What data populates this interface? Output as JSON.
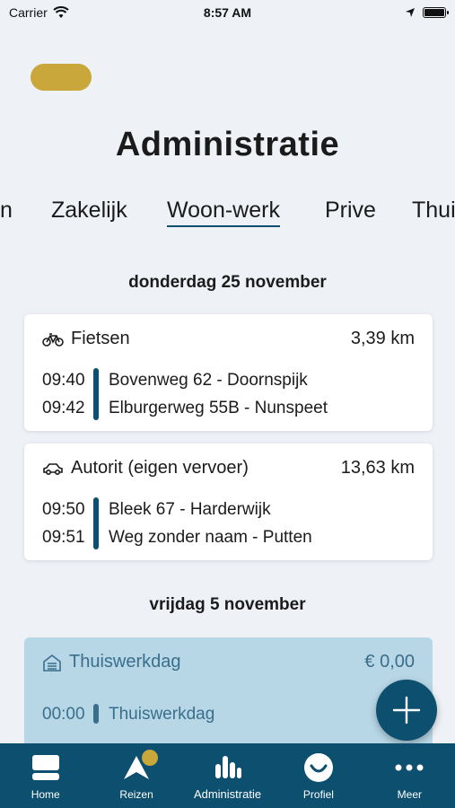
{
  "status_bar": {
    "carrier": "Carrier",
    "time": "8:57 AM"
  },
  "page": {
    "title": "Administratie"
  },
  "tabs": [
    {
      "label": "n",
      "active": false
    },
    {
      "label": "Zakelijk",
      "active": false
    },
    {
      "label": "Woon-werk",
      "active": true
    },
    {
      "label": "Prive",
      "active": false
    },
    {
      "label": "Thui",
      "active": false
    }
  ],
  "sections": [
    {
      "date": "donderdag 25 november",
      "trips": [
        {
          "mode_icon": "bicycle-icon",
          "mode": "Fietsen",
          "distance": "3,39 km",
          "from_time": "09:40",
          "from_addr": "Bovenweg 62 - Doornspijk",
          "to_time": "09:42",
          "to_addr": "Elburgerweg 55B - Nunspeet"
        },
        {
          "mode_icon": "car-icon",
          "mode": "Autorit (eigen vervoer)",
          "distance": "13,63 km",
          "from_time": "09:50",
          "from_addr": "Bleek 67 - Harderwijk",
          "to_time": "09:51",
          "to_addr": "Weg zonder naam - Putten"
        }
      ]
    },
    {
      "date": "vrijdag 5 november",
      "home_day": {
        "icon": "house-icon",
        "label": "Thuiswerkdag",
        "amount": "€ 0,00",
        "time": "00:00",
        "desc": "Thuiswerkdag"
      }
    }
  ],
  "bottom_nav": [
    {
      "label": "Home",
      "icon": "home-icon"
    },
    {
      "label": "Reizen",
      "icon": "navigation-icon",
      "badge": true
    },
    {
      "label": "Administratie",
      "icon": "bar-chart-icon",
      "active": true
    },
    {
      "label": "Profiel",
      "icon": "smiley-icon"
    },
    {
      "label": "Meer",
      "icon": "more-dots-icon"
    }
  ],
  "colors": {
    "primary": "#0d4f6e",
    "accent": "#c9a73a",
    "background": "#eef2f7",
    "home_card": "#b7d6e6"
  }
}
